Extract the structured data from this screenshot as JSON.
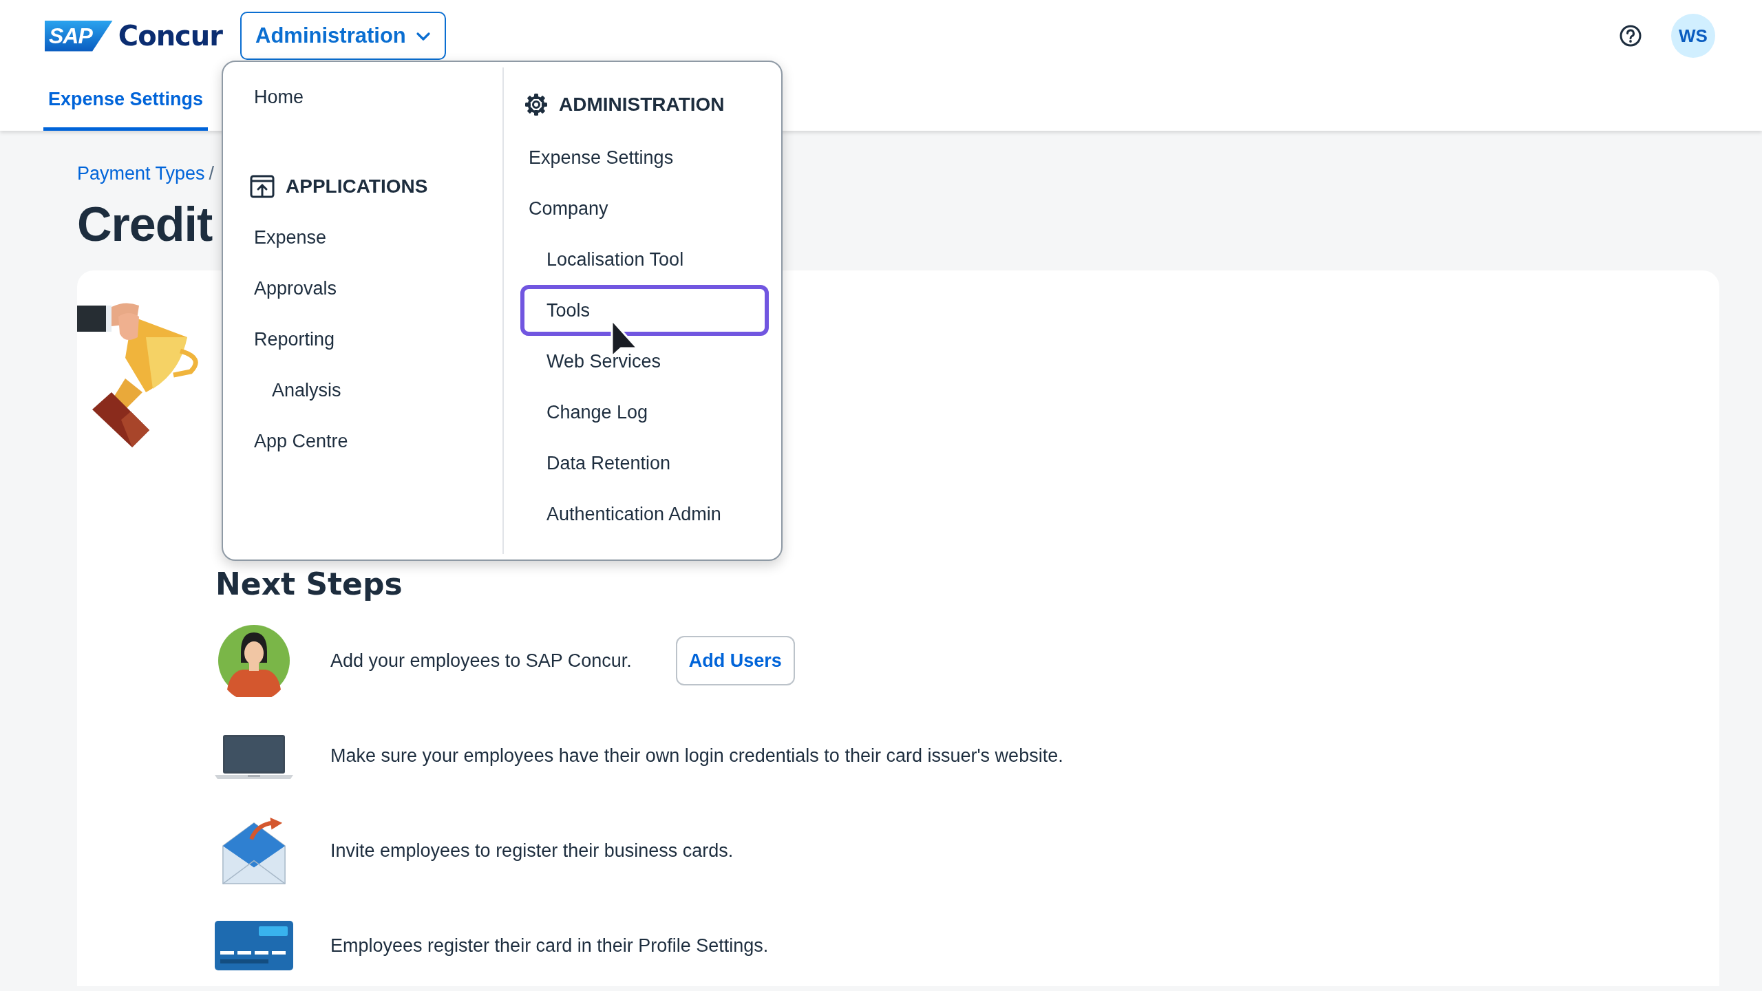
{
  "header": {
    "logo": {
      "badge": "SAP",
      "name": "Concur"
    },
    "menu_button": {
      "label": "Administration",
      "expanded": true
    },
    "avatar": "WS"
  },
  "tabs": [
    {
      "label": "Expense Settings",
      "selected": true
    }
  ],
  "breadcrumb": {
    "link": "Payment Types",
    "separator": "/"
  },
  "page_title": "Credit",
  "card": {
    "next_steps_title": "Next Steps",
    "steps": [
      {
        "kind": "person",
        "text": "Add your employees to SAP Concur.",
        "button": "Add Users"
      },
      {
        "kind": "laptop",
        "text": "Make sure your employees have their own login credentials to their card issuer's website."
      },
      {
        "kind": "mail",
        "text": "Invite employees to register their business cards."
      },
      {
        "kind": "card",
        "text": "Employees register their card in their Profile Settings."
      }
    ]
  },
  "dropdown": {
    "left": {
      "items": [
        {
          "kind": "link",
          "label": "Home",
          "selected": false
        },
        {
          "kind": "section",
          "label": "APPLICATIONS"
        },
        {
          "kind": "link",
          "label": "Expense",
          "selected": false
        },
        {
          "kind": "link",
          "label": "Approvals",
          "selected": false
        },
        {
          "kind": "link",
          "label": "Reporting",
          "selected": false,
          "children": [
            {
              "kind": "link",
              "label": "Analysis",
              "selected": false
            }
          ]
        },
        {
          "kind": "link",
          "label": "App Centre",
          "selected": false
        }
      ]
    },
    "right": {
      "items": [
        {
          "kind": "section",
          "label": "ADMINISTRATION"
        },
        {
          "kind": "link",
          "label": "Expense Settings",
          "selected": false
        },
        {
          "kind": "link",
          "label": "Company",
          "selected": false,
          "children": [
            {
              "kind": "link",
              "label": "Localisation Tool",
              "selected": false
            },
            {
              "kind": "link",
              "label": "Tools",
              "selected": true
            },
            {
              "kind": "link",
              "label": "Web Services",
              "selected": false
            },
            {
              "kind": "link",
              "label": "Change Log",
              "selected": false
            },
            {
              "kind": "link",
              "label": "Data Retention",
              "selected": false
            },
            {
              "kind": "link",
              "label": "Authentication Admin",
              "selected": false
            }
          ]
        }
      ]
    }
  }
}
